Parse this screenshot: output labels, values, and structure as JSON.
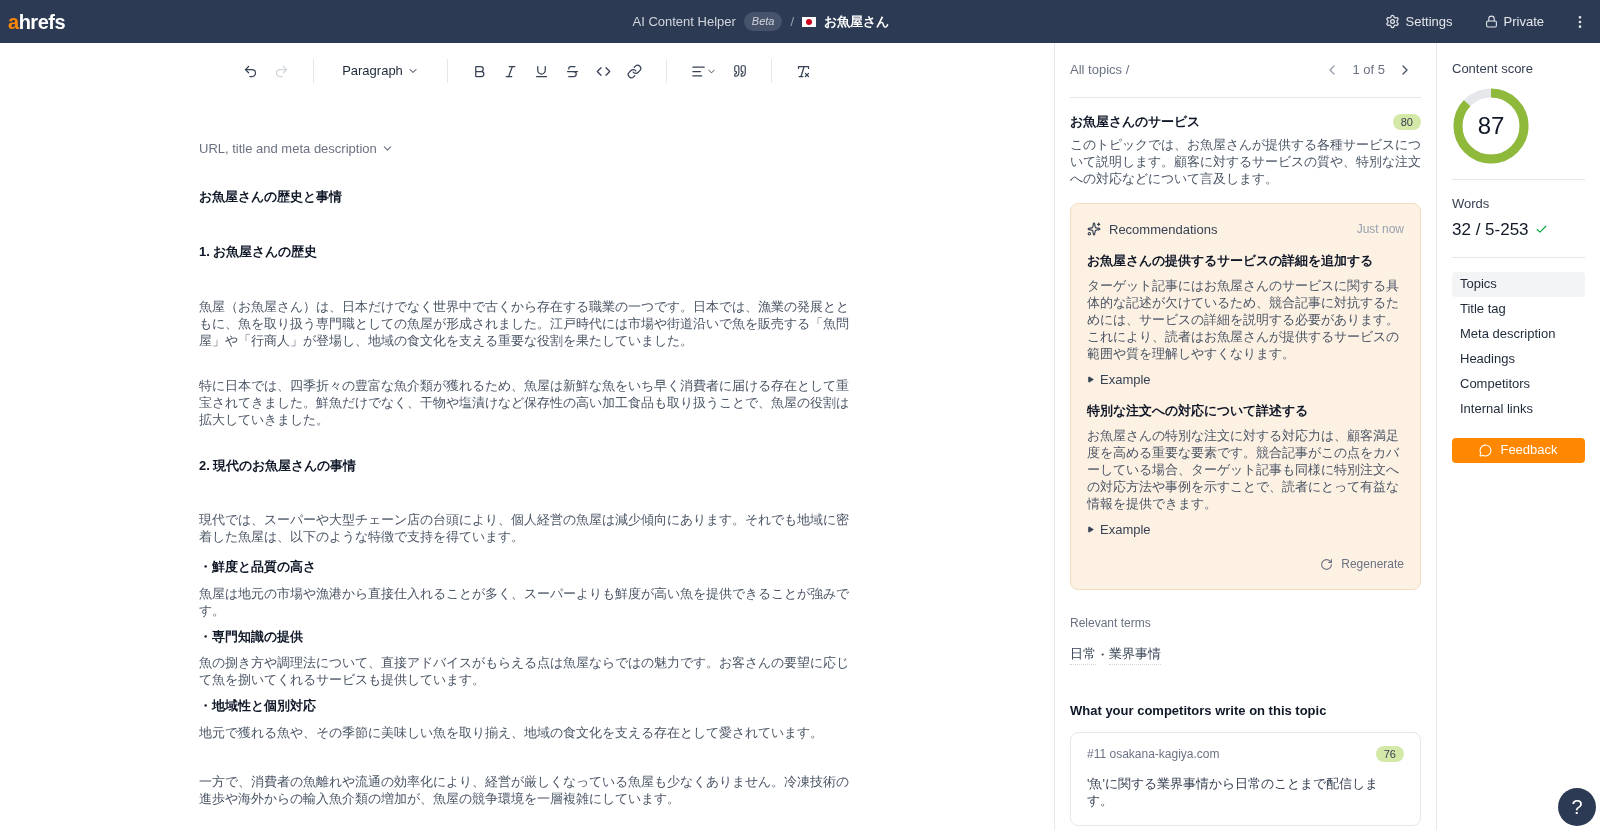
{
  "header": {
    "logo": {
      "accent": "a",
      "rest": "hrefs"
    },
    "app_name": "AI Content Helper",
    "badge": "Beta",
    "separator": "/",
    "project": "お魚屋さん",
    "settings": "Settings",
    "privacy": "Private"
  },
  "toolbar": {
    "undo": {
      "disabled": false
    },
    "redo": {
      "disabled": true
    },
    "block_style": "Paragraph"
  },
  "meta_toggle": {
    "label": "URL, title and meta description",
    "expanded": false
  },
  "document": [
    {
      "kind": "title",
      "text": "お魚屋さんの歴史と事情"
    },
    {
      "kind": "heading",
      "text": "1. お魚屋さんの歴史"
    },
    {
      "kind": "paragraph",
      "text": "魚屋（お魚屋さん）は、日本だけでなく世界中で古くから存在する職業の一つです。日本では、漁業の発展とともに、魚を取り扱う専門職としての魚屋が形成されました。江戸時代には市場や街道沿いで魚を販売する「魚問屋」や「行商人」が登場し、地域の食文化を支える重要な役割を果たしていました。"
    },
    {
      "kind": "paragraph",
      "text": "特に日本では、四季折々の豊富な魚介類が獲れるため、魚屋は新鮮な魚をいち早く消費者に届ける存在として重宝されてきました。鮮魚だけでなく、干物や塩漬けなど保存性の高い加工食品も取り扱うことで、魚屋の役割は拡大していきました。"
    },
    {
      "kind": "heading",
      "text": "2. 現代のお魚屋さんの事情"
    },
    {
      "kind": "paragraph",
      "text": "現代では、スーパーや大型チェーン店の台頭により、個人経営の魚屋は減少傾向にあります。それでも地域に密着した魚屋は、以下のような特徴で支持を得ています。"
    },
    {
      "kind": "bullet",
      "text": "・鮮度と品質の高さ"
    },
    {
      "kind": "item",
      "text": "魚屋は地元の市場や漁港から直接仕入れることが多く、スーパーよりも鮮度が高い魚を提供できることが強みです。"
    },
    {
      "kind": "bullet",
      "text": "・専門知識の提供"
    },
    {
      "kind": "item",
      "text": "魚の捌き方や調理法について、直接アドバイスがもらえる点は魚屋ならではの魅力です。お客さんの要望に応じて魚を捌いてくれるサービスも提供しています。"
    },
    {
      "kind": "bullet",
      "text": "・地域性と個別対応"
    },
    {
      "kind": "item",
      "text": "地元で獲れる魚や、その季節に美味しい魚を取り揃え、地域の食文化を支える存在として愛されています。"
    },
    {
      "kind": "paragraph",
      "text": "一方で、消費者の魚離れや流通の効率化により、経営が厳しくなっている魚屋も少なくありません。冷凍技術の進歩や海外からの輸入魚介類の増加が、魚屋の競争環境を一層複雑にしています。"
    }
  ],
  "topics": {
    "breadcrumb": "All topics /",
    "pager": "1 of 5",
    "title": "お魚屋さんのサービス",
    "score": "80",
    "description": "このトピックでは、お魚屋さんが提供する各種サービスについて説明します。顧客に対するサービスの質や、特別な注文への対応などについて言及します。",
    "recommendations": {
      "title": "Recommendations",
      "time": "Just now",
      "items": [
        {
          "title": "お魚屋さんの提供するサービスの詳細を追加する",
          "body": "ターゲット記事にはお魚屋さんのサービスに関する具体的な記述が欠けているため、競合記事に対抗するためには、サービスの詳細を説明する必要があります。これにより、読者はお魚屋さんが提供するサービスの範囲や質を理解しやすくなります。",
          "example": "Example",
          "expanded": false
        },
        {
          "title": "特別な注文への対応について詳述する",
          "body": "お魚屋さんの特別な注文に対する対応力は、顧客満足度を高める重要な要素です。競合記事がこの点をカバーしている場合、ターゲット記事も同様に特別注文への対応方法や事例を示すことで、読者にとって有益な情報を提供できます。",
          "example": "Example",
          "expanded": false
        }
      ],
      "regenerate": "Regenerate"
    },
    "relevant_terms": {
      "label": "Relevant terms",
      "terms": [
        "日常",
        "業界事情"
      ],
      "separator": "・"
    },
    "competitors": {
      "heading": "What your competitors write on this topic",
      "items": [
        {
          "source": "#11 osakana-kagiya.com",
          "score": "76",
          "text": "'魚'に関する業界事情から日常のことまで配信します。"
        }
      ]
    }
  },
  "sidebar": {
    "score_label": "Content score",
    "score": "87",
    "level": 0.87,
    "words_label": "Words",
    "words": "32 / 5-253",
    "words_ok": true,
    "nav": [
      {
        "label": "Topics",
        "selected": true
      },
      {
        "label": "Title tag",
        "selected": false
      },
      {
        "label": "Meta description",
        "selected": false
      },
      {
        "label": "Headings",
        "selected": false
      },
      {
        "label": "Competitors",
        "selected": false
      },
      {
        "label": "Internal links",
        "selected": false
      }
    ],
    "feedback": "Feedback"
  },
  "help": "?"
}
